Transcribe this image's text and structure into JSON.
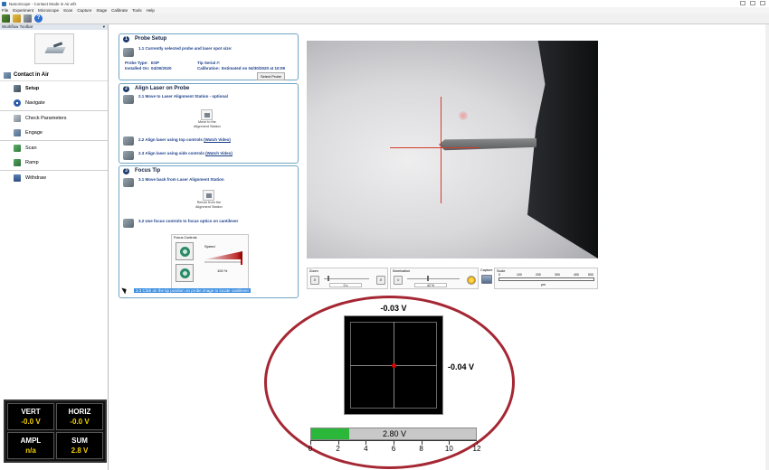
{
  "window": {
    "title": "NanoScope - Contact Mode in Air.wfz"
  },
  "menu": [
    "File",
    "Experiment",
    "Microscope",
    "Scan",
    "Capture",
    "Stage",
    "Calibrate",
    "Tools",
    "Help"
  ],
  "toolbar": {
    "icons": [
      "probe-icon",
      "folder-open-icon",
      "save-icon",
      "help-icon"
    ]
  },
  "workflow": {
    "header": "Workflow Toolbar",
    "mode": "Contact in Air",
    "items": [
      {
        "label": "Setup",
        "icon": "setup-icon",
        "selected": true
      },
      {
        "label": "Navigate",
        "icon": "navigate-icon"
      },
      {
        "label": "Check Parameters",
        "icon": "check-parameters-icon"
      },
      {
        "label": "Engage",
        "icon": "engage-icon"
      },
      {
        "label": "Scan",
        "icon": "scan-icon"
      },
      {
        "label": "Ramp",
        "icon": "ramp-icon"
      },
      {
        "label": "Withdraw",
        "icon": "withdraw-icon"
      }
    ]
  },
  "signals": {
    "vert": {
      "name": "VERT",
      "value": "-0.0  V"
    },
    "horiz": {
      "name": "HORIZ",
      "value": "-0.0  V"
    },
    "ampl": {
      "name": "AMPL",
      "value": "n/a"
    },
    "sum": {
      "name": "SUM",
      "value": "2.8  V"
    },
    "value_color": "#f2d100"
  },
  "steps": {
    "s1": {
      "num": "1",
      "title": "Probe Setup",
      "sub": "1.1 Currently selected probe and laser spot size:",
      "probe_type_label": "Probe Type:",
      "probe_type": "ESP",
      "installed_label": "Installed On:",
      "installed": "04/30/2020",
      "tip_serial_label": "Tip Serial #:",
      "calibration_label": "Calibration:",
      "calibration": "Estimated on 04/30/2020 at 10:09",
      "select_probe": "Select Probe"
    },
    "s2": {
      "num": "2",
      "title": "Align Laser on Probe",
      "sub1": "2.1 Move to Laser Alignment Station - optional",
      "station_caption_1": "Move to the",
      "station_caption_2": "Alignment Station",
      "sub2": "2.2 Align laser using top controls",
      "sub3": "2.3 Align laser using side controls",
      "watch_video": "(Watch Video)"
    },
    "s3": {
      "num": "3",
      "title": "Focus Tip",
      "sub1": "3.1 Move back from Laser Alignment Station",
      "return_caption_1": "Return from the",
      "return_caption_2": "Alignment Station",
      "sub2": "3.2 Use focus controls to focus optics on cantilever",
      "focus_controls": "Focus Controls",
      "speed": "Speed",
      "speed_pct": "100 %",
      "sub3": "3.3 Click on the tip position on probe image to locate cantilever"
    }
  },
  "camera_controls": {
    "zoom": "Zoom",
    "zoom_value": "0 x",
    "illumination": "Illumination",
    "illumination_value": "42 %",
    "capture": "Capture",
    "scale": "Scale",
    "scale_ticks": [
      "0",
      "100",
      "200",
      "300",
      "400",
      "500"
    ],
    "scale_unit": "µm"
  },
  "laser": {
    "vertical_readout": "-0.03 V",
    "horizontal_readout": "-0.04 V",
    "sum_readout": "2.80  V",
    "sum_fraction": 0.233,
    "sum_axis_ticks": [
      "0",
      "2",
      "4",
      "6",
      "8",
      "10",
      "12"
    ],
    "ring_color": "#a52733",
    "sum_fill_color": "#2bb83a",
    "spot_color": "#e00000"
  }
}
